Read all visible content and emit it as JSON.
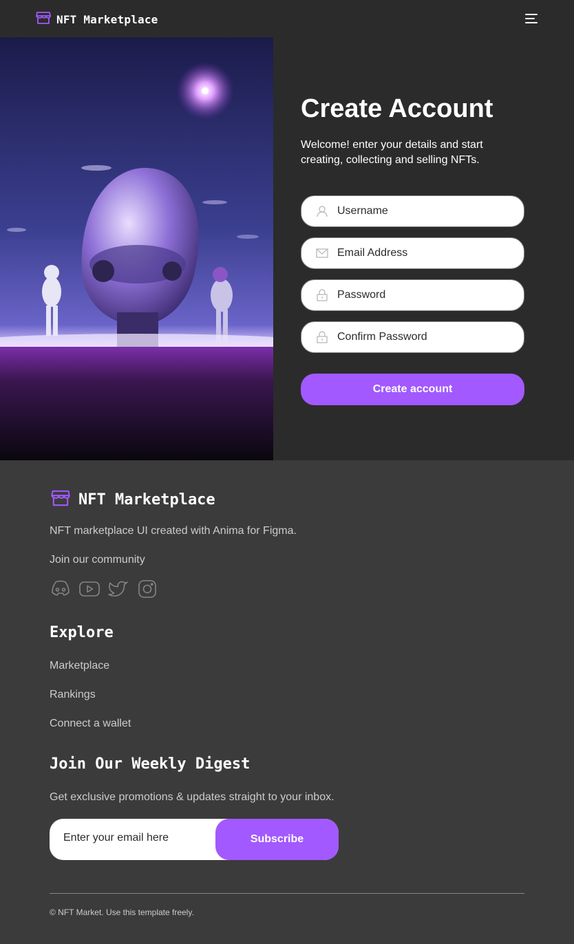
{
  "header": {
    "brand": "NFT Marketplace",
    "brand_icon": "storefront-icon",
    "menu_icon": "hamburger-menu-icon"
  },
  "hero": {
    "image": "astronaut-spaceship-artwork"
  },
  "form": {
    "title": "Create Account",
    "subtitle": "Welcome! enter your details and start creating, collecting and selling NFTs.",
    "fields": [
      {
        "placeholder": "Username",
        "icon": "user-icon"
      },
      {
        "placeholder": "Email Address",
        "icon": "envelope-icon"
      },
      {
        "placeholder": "Password",
        "icon": "lock-icon"
      },
      {
        "placeholder": "Confirm Password",
        "icon": "lock-icon"
      }
    ],
    "submit_label": "Create account"
  },
  "footer": {
    "brand": "NFT Marketplace",
    "tagline": "NFT marketplace UI created with Anima for Figma.",
    "community": "Join our community",
    "socials": [
      "discord-icon",
      "youtube-icon",
      "twitter-icon",
      "instagram-icon"
    ],
    "explore_heading": "Explore",
    "explore_links": [
      "Marketplace",
      "Rankings",
      "Connect a wallet"
    ],
    "digest_heading": "Join Our Weekly Digest",
    "digest_text": "Get exclusive promotions & updates straight to your inbox.",
    "email_placeholder": "Enter your email here",
    "subscribe_label": "Subscribe",
    "copyright": "© NFT Market. Use this template freely."
  },
  "colors": {
    "accent": "#a259ff",
    "background": "#2b2b2b",
    "footer_bg": "#3b3b3b"
  }
}
